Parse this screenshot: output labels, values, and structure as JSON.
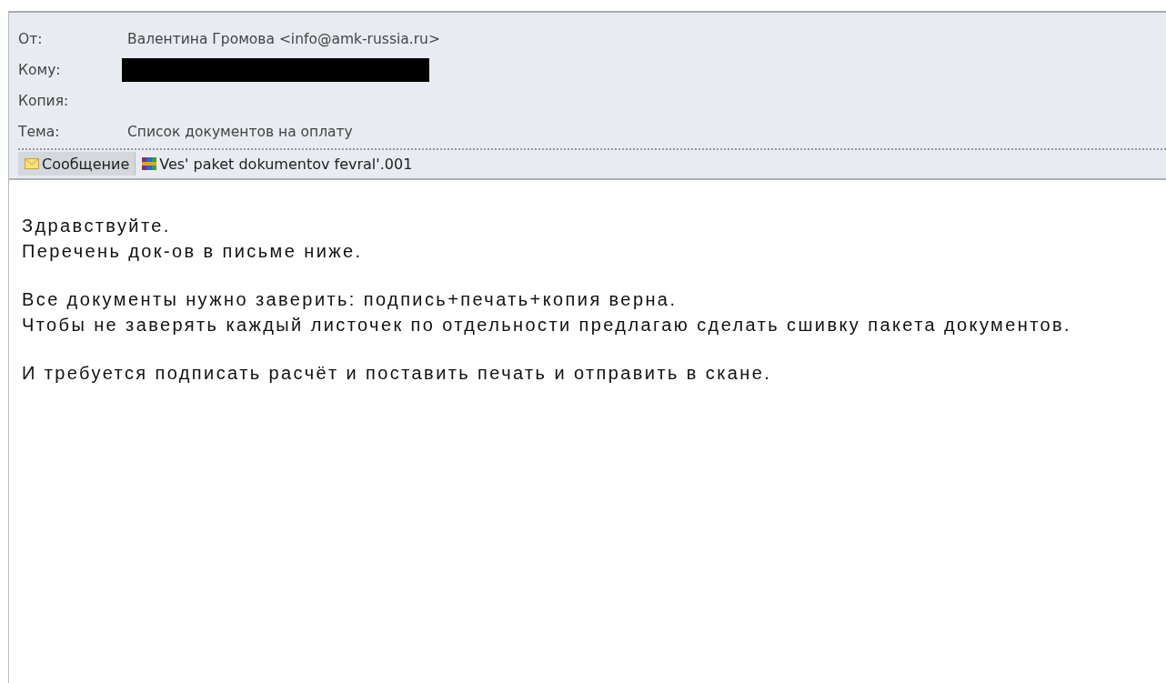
{
  "header": {
    "fields": [
      {
        "label": "От:",
        "value": "Валентина Громова <info@amk-russia.ru>",
        "redacted": false
      },
      {
        "label": "Кому:",
        "redacted": true
      },
      {
        "label": "Копия:",
        "redacted": false
      },
      {
        "label": "Тема:",
        "value": "Список документов на оплату",
        "redacted": false
      }
    ]
  },
  "tabs": [
    {
      "kind": "message",
      "label": "Сообщение",
      "selected": true
    },
    {
      "kind": "attachment",
      "label": "Ves' paket dokumentov fevral'.001",
      "selected": false
    }
  ],
  "body": {
    "paragraphs": [
      [
        "Здравствуйте.",
        "Перечень док-ов в письме ниже."
      ],
      [
        "Все документы нужно заверить: подпись+печать+копия верна.",
        "Чтобы не заверять каждый листочек по отдельности предлагаю сделать сшивку пакета документов."
      ],
      [
        "И требуется подписать расчёт и поставить печать и отправить в скане."
      ]
    ]
  }
}
